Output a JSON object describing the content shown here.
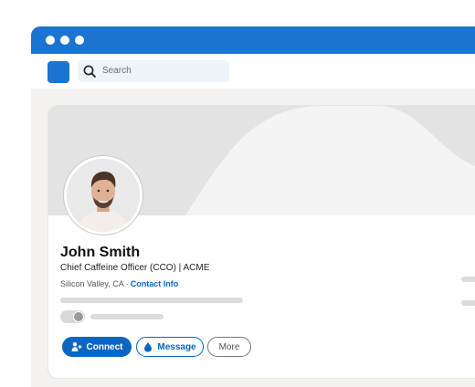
{
  "search": {
    "placeholder": "Search"
  },
  "profile": {
    "name": "John Smith",
    "headline": "Chief Caffeine Officer (CCO) | ACME",
    "location": "Silicon Valley, CA",
    "separator": "·",
    "contact_info_label": "Contact Info"
  },
  "actions": {
    "connect_label": "Connect",
    "message_label": "Message",
    "more_label": "More"
  },
  "colors": {
    "brand_blue": "#1a74d0",
    "link_blue": "#0a66c2",
    "page_bg": "#f3f2ef",
    "banner_gray": "#e3e3e3"
  },
  "icons": [
    "search-icon",
    "add-person-icon",
    "message-drop-icon",
    "person-icon"
  ]
}
